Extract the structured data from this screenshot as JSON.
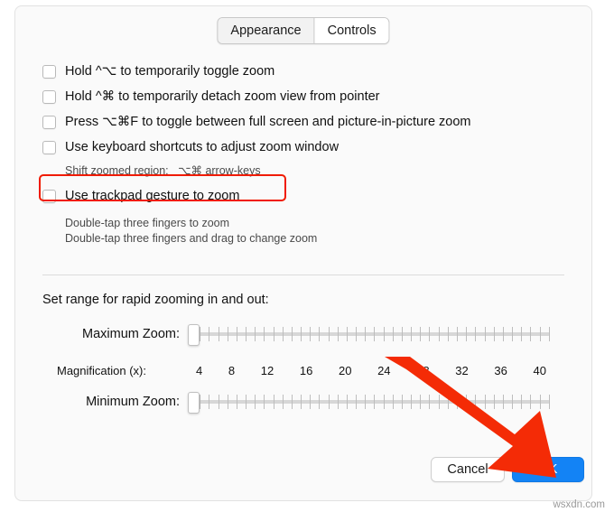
{
  "tabs": [
    {
      "label": "Appearance",
      "active": false
    },
    {
      "label": "Controls",
      "active": true
    }
  ],
  "options": [
    {
      "label": "Hold ^⌥ to temporarily toggle zoom",
      "checked": false,
      "notes": []
    },
    {
      "label": "Hold ^⌘ to temporarily detach zoom view from pointer",
      "checked": false,
      "notes": []
    },
    {
      "label": "Press ⌥⌘F to toggle between full screen and picture-in-picture zoom",
      "checked": false,
      "notes": []
    },
    {
      "label": "Use keyboard shortcuts to adjust zoom window",
      "checked": false,
      "notes": [
        "Shift zoomed region:   ⌥⌘ arrow-keys"
      ]
    },
    {
      "label": "Use trackpad gesture to zoom",
      "checked": false,
      "notes": [
        "Double-tap three fingers to zoom",
        "Double-tap three fingers and drag to change zoom"
      ]
    }
  ],
  "section": {
    "title": "Set range for rapid zooming in and out:"
  },
  "sliders": {
    "maximum": {
      "label": "Maximum Zoom:",
      "knob_percent": 0,
      "tick_count": 40
    },
    "minimum": {
      "label": "Minimum Zoom:",
      "knob_percent": 0,
      "tick_count": 40
    },
    "magnification": {
      "label": "Magnification (x):",
      "values": [
        "4",
        "8",
        "12",
        "16",
        "20",
        "24",
        "28",
        "32",
        "36",
        "40"
      ]
    }
  },
  "buttons": {
    "cancel": "Cancel",
    "ok": "OK"
  },
  "annotation": {
    "highlight_color": "#f01b00",
    "arrow_color": "#f42b06"
  },
  "watermark": "wsxdn.com"
}
